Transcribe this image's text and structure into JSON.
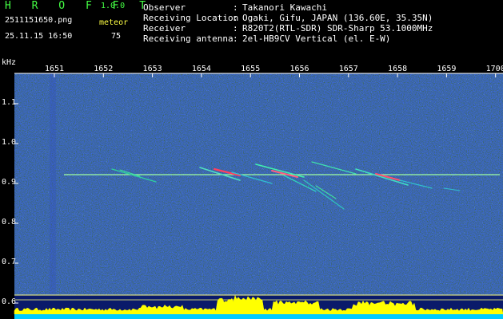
{
  "header": {
    "brand": "H R O F F T",
    "version": "1.0.0",
    "filename": "2511151650.png",
    "meteor_label": "meteor",
    "timestamp": "25.11.15 16:50",
    "meteor_count": "75"
  },
  "info": [
    {
      "label": "Observer",
      "value": "Takanori Kawachi"
    },
    {
      "label": "Receiving Location",
      "value": "Ogaki, Gifu, JAPAN (136.60E, 35.35N)"
    },
    {
      "label": "Receiver",
      "value": "R820T2(RTL-SDR) SDR-Sharp 53.1000MHz"
    },
    {
      "label": "Receiving antenna",
      "value": "2el-HB9CV Vertical (el. E-W)"
    }
  ],
  "plot": {
    "unit_label": "kHz",
    "time_ticks": [
      "1651",
      "1652",
      "1653",
      "1654",
      "1655",
      "1656",
      "1657",
      "1658",
      "1659",
      "1700"
    ],
    "freq_ticks": [
      "1.1",
      "1.0",
      "0.9",
      "0.8",
      "0.7",
      "0.6"
    ],
    "colors": {
      "background": "#0a1a6a",
      "tick": "#ffffff",
      "carrier": "#a0ffa0",
      "spectrum": "#ffff00",
      "baseline": "#00ccff"
    }
  }
}
